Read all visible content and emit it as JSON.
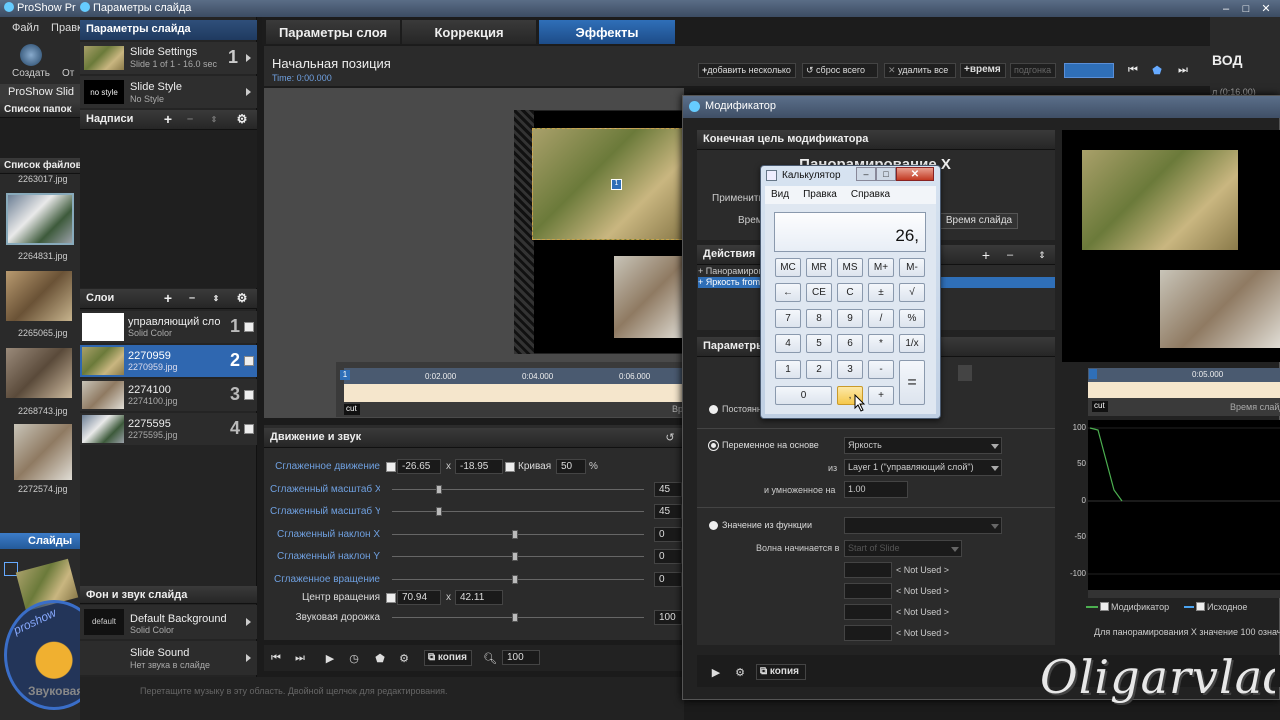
{
  "taskbar": {
    "app1": "ProShow Pro",
    "app2": "Параметры слайда"
  },
  "main_menu": {
    "file": "Файл",
    "edit": "Правка"
  },
  "main_toolbar": {
    "create": "Создать",
    "open_short": "От"
  },
  "proshow_slide": "ProShow Slid",
  "folders_label": "Список папок",
  "files_label": "Список файлов",
  "files": [
    {
      "name": "2263017.jpg"
    },
    {
      "name": "2264831.jpg"
    },
    {
      "name": "2265065.jpg"
    },
    {
      "name": "2268743.jpg"
    },
    {
      "name": "2272574.jpg"
    }
  ],
  "slides_label": "Слайды",
  "slide_params": {
    "header": "Параметры слайда",
    "settings_title": "Slide Settings",
    "settings_sub": "Slide 1 of 1 - 16.0 sec",
    "settings_num": "1",
    "style_thumb": "no style",
    "style_title": "Slide Style",
    "style_sub": "No Style",
    "captions_label": "Надписи",
    "layers_label": "Слои",
    "layers": [
      {
        "title": "управляющий слой",
        "sub": "Solid Color",
        "num": "1"
      },
      {
        "title": "2270959",
        "sub": "2270959.jpg",
        "num": "2"
      },
      {
        "title": "2274100",
        "sub": "2274100.jpg",
        "num": "3"
      },
      {
        "title": "2275595",
        "sub": "2275595.jpg",
        "num": "4"
      }
    ],
    "bg_sound_label": "Фон и звук слайда",
    "bg_title": "Default Background",
    "bg_sub": "Solid Color",
    "bg_thumb": "default",
    "sound_title": "Slide Sound",
    "sound_sub": "Нет звука в слайде"
  },
  "tabs": {
    "layer_params": "Параметры слоя",
    "correction": "Коррекция",
    "effects": "Эффекты"
  },
  "keyframe": {
    "title": "Начальная позиция",
    "time": "Time: 0:00.000",
    "add": "добавить",
    "several": "несколько",
    "reset_all": "сброс всего",
    "delete_all": "удалить все",
    "time_btn": "время",
    "fit": "подгонка"
  },
  "right_strip": {
    "output": "ВОД",
    "duration": "л (0:16.00)"
  },
  "timeline": {
    "marker": "1",
    "ticks": [
      "0:02.000",
      "0:04.000",
      "0:06.000"
    ],
    "cut": "cut",
    "right_label": "Вр"
  },
  "motion": {
    "header": "Движение и звук",
    "smooth_motion": "Сглаженное движение",
    "pos_x": "-26.65",
    "pos_y": "-18.95",
    "curve": "Кривая",
    "curve_val": "50",
    "curve_unit": "%",
    "x_sep": "x",
    "scale_x": "Сглаженный масштаб X",
    "scale_x_val": "45",
    "scale_y": "Сглаженный масштаб Y",
    "scale_y_val": "45",
    "tilt_x": "Сглаженный наклон X",
    "tilt_x_val": "0",
    "tilt_y": "Сглаженный наклон Y",
    "tilt_y_val": "0",
    "rotate": "Сглаженное вращение",
    "rotate_val": "0",
    "center": "Центр вращения",
    "center_x": "70.94",
    "center_y": "42.11",
    "sound_track": "Звуковая дорожка",
    "sound_val": "100"
  },
  "bottom_toolbar": {
    "copy": "копия",
    "zoom": "100"
  },
  "footer": {
    "audio_track": "Звуковая дорожка",
    "hint": "Перетащите музыку в эту область. Двойной щелчок для редактирования."
  },
  "modifier": {
    "title": "Модификатор",
    "target_header": "Конечная цель модификатора",
    "target_value": "Панорамирование X",
    "apply_label": "Применить",
    "time_label": "Время",
    "slide_time_btn": "Время слайда",
    "actions_header": "Действия",
    "actions": [
      "+ Панорамиров",
      "+ Яркость from"
    ],
    "params_header": "Параметры",
    "constant": "Постоянн",
    "variable_label": "Переменное на основе",
    "variable_value": "Яркость",
    "from_label": "из",
    "from_value": "Layer 1 (\"управляющий слой\")",
    "multiplied_label": "и умноженное на",
    "multiplied_value": "1.00",
    "function_label": "Значение из функции",
    "wave_label": "Волна начинается в",
    "wave_value": "Start of Slide",
    "not_used": [
      "< Not Used >",
      "< Not Used >",
      "< Not Used >",
      "< Not Used >"
    ],
    "copy_btn": "копия",
    "timeline_tick": "0:05.000",
    "timeline_right": "Время слайда",
    "graph_ticks": [
      "100",
      "50",
      "0",
      "-50",
      "-100"
    ],
    "legend_modifier": "Модификатор",
    "legend_source": "Исходное",
    "status_text": "Для панорамирования X значение 100 означ"
  },
  "calculator": {
    "title": "Калькулятор",
    "menu": [
      "Вид",
      "Правка",
      "Справка"
    ],
    "display": "26,",
    "rows": [
      [
        "MC",
        "MR",
        "MS",
        "M+",
        "M-"
      ],
      [
        "←",
        "CE",
        "C",
        "±",
        "√"
      ],
      [
        "7",
        "8",
        "9",
        "/",
        "%"
      ],
      [
        "4",
        "5",
        "6",
        "*",
        "1/x"
      ],
      [
        "1",
        "2",
        "3",
        "-",
        "="
      ],
      [
        "0",
        ",",
        "+"
      ]
    ]
  },
  "watermark": "Oligarvlad",
  "logo_text": "proshow"
}
